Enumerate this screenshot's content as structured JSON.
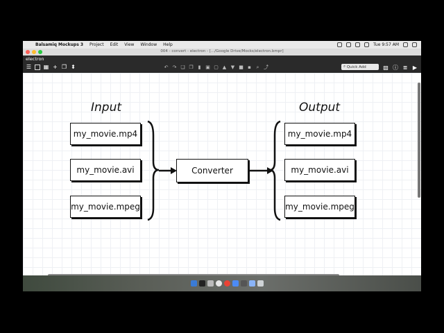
{
  "menubar": {
    "app_name": "Balsamiq Mockups 3",
    "items": [
      "Project",
      "Edit",
      "View",
      "Window",
      "Help"
    ],
    "clock": "Tue 9:57 AM"
  },
  "window": {
    "title": "004 - convert - electron - [.../Google Drive/Mocks/electron.bmpr]"
  },
  "appbar": {
    "tab_label": "electron",
    "quick_add_placeholder": "Quick Add"
  },
  "diagram": {
    "input_label": "Input",
    "output_label": "Output",
    "inputs": [
      "my_movie.mp4",
      "my_movie.avi",
      "my_movie.mpeg"
    ],
    "converter": "Converter",
    "outputs": [
      "my_movie.mp4",
      "my_movie.avi",
      "my_movie.mpeg"
    ]
  },
  "icons": {
    "menu": "hamburger-icon",
    "search": "search-icon",
    "info": "info-icon"
  },
  "colors": {
    "appbar_bg": "#2a2a2a",
    "close": "#fc5f57",
    "minimize": "#fdbc2e",
    "zoom": "#28c840"
  }
}
